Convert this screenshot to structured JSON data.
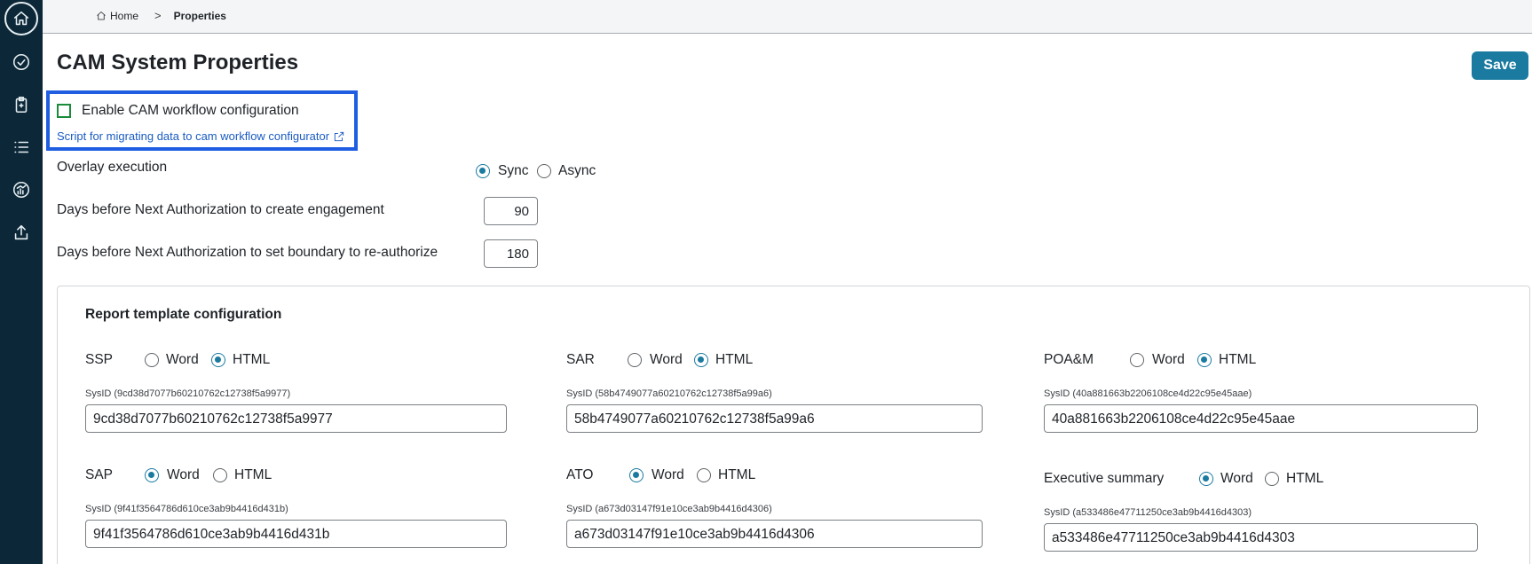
{
  "sidebar": {
    "items": [
      {
        "icon": "home-icon"
      },
      {
        "icon": "check-circle-icon"
      },
      {
        "icon": "clipboard-icon"
      },
      {
        "icon": "list-icon"
      },
      {
        "icon": "dashboard-icon"
      },
      {
        "icon": "upload-icon"
      }
    ]
  },
  "breadcrumb": {
    "home": "Home",
    "separator": ">",
    "current": "Properties"
  },
  "page": {
    "title": "CAM System Properties",
    "save_label": "Save"
  },
  "workflow": {
    "checkbox_label": "Enable CAM workflow configuration",
    "checked": false,
    "link_text": "Script for migrating data to cam workflow configurator"
  },
  "overlay": {
    "label": "Overlay execution",
    "options": [
      "Sync",
      "Async"
    ],
    "selected": "Sync"
  },
  "engagement": {
    "label": "Days before Next Authorization to create engagement",
    "value": "90"
  },
  "boundary": {
    "label": "Days before Next Authorization to set boundary to re-authorize",
    "value": "180"
  },
  "report": {
    "title": "Report template configuration",
    "items": [
      {
        "label": "SSP",
        "word": "Word",
        "html": "HTML",
        "selected": "HTML",
        "sysid_label": "SysID (9cd38d7077b60210762c12738f5a9977)",
        "sysid_value": "9cd38d7077b60210762c12738f5a9977"
      },
      {
        "label": "SAR",
        "word": "Word",
        "html": "HTML",
        "selected": "HTML",
        "sysid_label": "SysID (58b4749077a60210762c12738f5a99a6)",
        "sysid_value": "58b4749077a60210762c12738f5a99a6"
      },
      {
        "label": "POA&M",
        "word": "Word",
        "html": "HTML",
        "selected": "HTML",
        "sysid_label": "SysID (40a881663b2206108ce4d22c95e45aae)",
        "sysid_value": "40a881663b2206108ce4d22c95e45aae"
      },
      {
        "label": "SAP",
        "word": "Word",
        "html": "HTML",
        "selected": "Word",
        "sysid_label": "SysID (9f41f3564786d610ce3ab9b4416d431b)",
        "sysid_value": "9f41f3564786d610ce3ab9b4416d431b"
      },
      {
        "label": "ATO",
        "word": "Word",
        "html": "HTML",
        "selected": "Word",
        "sysid_label": "SysID (a673d03147f91e10ce3ab9b4416d4306)",
        "sysid_value": "a673d03147f91e10ce3ab9b4416d4306"
      },
      {
        "label": "Executive summary",
        "word": "Word",
        "html": "HTML",
        "selected": "Word",
        "sysid_label": "SysID (a533486e47711250ce3ab9b4416d4303)",
        "sysid_value": "a533486e47711250ce3ab9b4416d4303"
      }
    ]
  },
  "colors": {
    "rail": "#0c2838",
    "accent": "#1a7aa0",
    "highlight": "#1f5ee0",
    "link": "#1a5bc2",
    "checkbox_border": "#1b8a3a"
  }
}
